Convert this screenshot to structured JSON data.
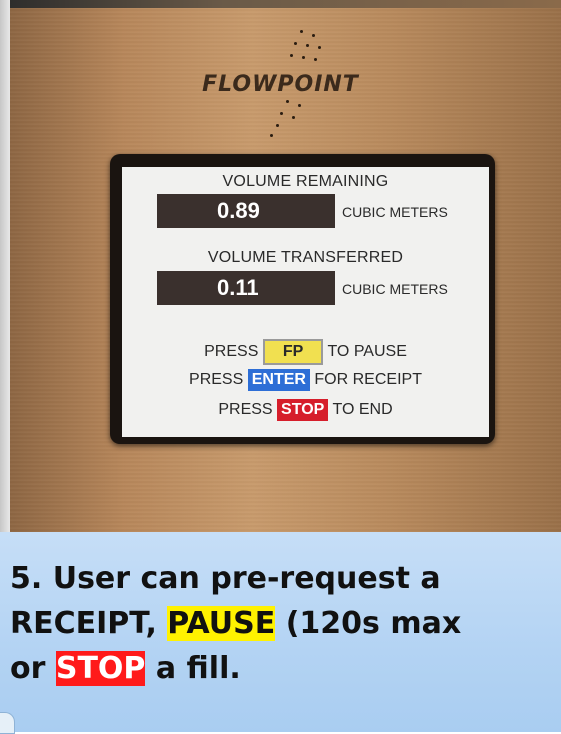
{
  "device": {
    "brand": "FLOWPOINT"
  },
  "screen": {
    "volume_remaining_label": "VOLUME REMAINING",
    "volume_remaining_value": "0.89",
    "volume_remaining_unit": "CUBIC METERS",
    "volume_transferred_label": "VOLUME TRANSFERRED",
    "volume_transferred_value": "0.11",
    "volume_transferred_unit": "CUBIC METERS",
    "instructions": [
      {
        "prefix": "PRESS",
        "key": "FP",
        "suffix": "TO PAUSE"
      },
      {
        "prefix": "PRESS",
        "key": "ENTER",
        "suffix": "FOR RECEIPT"
      },
      {
        "prefix": "PRESS",
        "key": "STOP",
        "suffix": "TO END"
      }
    ]
  },
  "caption": {
    "line1": "5. User can pre-request a",
    "line2_pre": "RECEIPT, ",
    "line2_hl": "PAUSE",
    "line2_post": " (120s max",
    "line3_pre": "or ",
    "line3_hl": "STOP",
    "line3_post": " a fill."
  },
  "colors": {
    "fp_key": "#f1e050",
    "enter_key": "#2d6ed6",
    "stop_key": "#d61e2b",
    "highlight_yellow": "#fff200",
    "highlight_red": "#ff1a1a"
  }
}
